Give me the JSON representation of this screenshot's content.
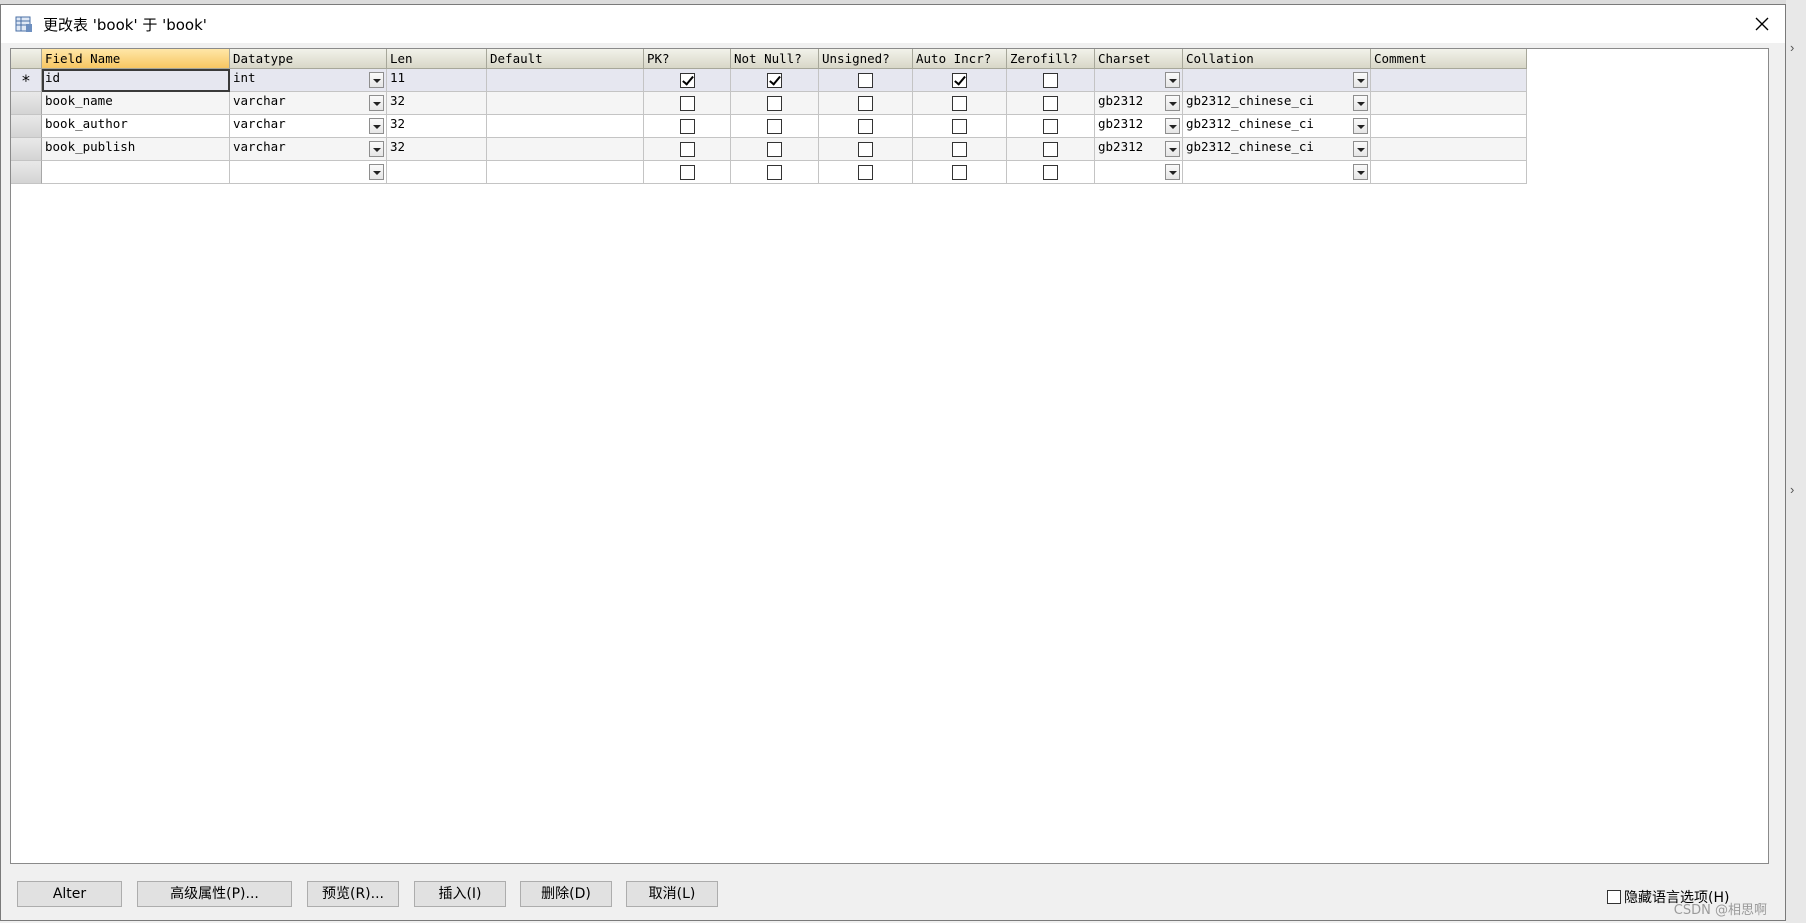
{
  "window": {
    "title": "更改表 'book' 于 'book'"
  },
  "columns": [
    {
      "label": "Field Name"
    },
    {
      "label": "Datatype"
    },
    {
      "label": "Len"
    },
    {
      "label": "Default"
    },
    {
      "label": "PK?"
    },
    {
      "label": "Not Null?"
    },
    {
      "label": "Unsigned?"
    },
    {
      "label": "Auto Incr?"
    },
    {
      "label": "Zerofill?"
    },
    {
      "label": "Charset"
    },
    {
      "label": "Collation"
    },
    {
      "label": "Comment"
    }
  ],
  "rows": [
    {
      "marker": "*",
      "field": "id",
      "datatype": "int",
      "len": "11",
      "default": "",
      "pk": true,
      "notnull": true,
      "unsigned": false,
      "autoincr": true,
      "zerofill": false,
      "charset": "",
      "collation": "",
      "comment": ""
    },
    {
      "marker": "",
      "field": "book_name",
      "datatype": "varchar",
      "len": "32",
      "default": "",
      "pk": false,
      "notnull": false,
      "unsigned": false,
      "autoincr": false,
      "zerofill": false,
      "charset": "gb2312",
      "collation": "gb2312_chinese_ci",
      "comment": ""
    },
    {
      "marker": "",
      "field": "book_author",
      "datatype": "varchar",
      "len": "32",
      "default": "",
      "pk": false,
      "notnull": false,
      "unsigned": false,
      "autoincr": false,
      "zerofill": false,
      "charset": "gb2312",
      "collation": "gb2312_chinese_ci",
      "comment": ""
    },
    {
      "marker": "",
      "field": "book_publish",
      "datatype": "varchar",
      "len": "32",
      "default": "",
      "pk": false,
      "notnull": false,
      "unsigned": false,
      "autoincr": false,
      "zerofill": false,
      "charset": "gb2312",
      "collation": "gb2312_chinese_ci",
      "comment": ""
    },
    {
      "marker": "",
      "field": "",
      "datatype": "",
      "len": "",
      "default": "",
      "pk": false,
      "notnull": false,
      "unsigned": false,
      "autoincr": false,
      "zerofill": false,
      "charset": "",
      "collation": "",
      "comment": ""
    }
  ],
  "buttons": {
    "alter": "Alter",
    "advanced": "高级属性(P)...",
    "preview": "预览(R)...",
    "insert": "插入(I)",
    "delete": "删除(D)",
    "cancel": "取消(L)"
  },
  "hide_lang": {
    "label": "隐藏语言选项(H)",
    "checked": false
  },
  "watermark": "CSDN @相思啊"
}
